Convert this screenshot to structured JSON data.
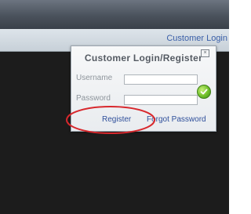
{
  "header": {
    "nav_link": "Customer Login"
  },
  "login_panel": {
    "title": "Customer Login/Register",
    "close_icon": "close-icon",
    "username_label": "Username",
    "username_value": "",
    "password_label": "Password",
    "password_value": "",
    "submit_icon": "checkmark-icon",
    "register_link": "Register",
    "forgot_link": "Forgot Password"
  },
  "colors": {
    "link": "#2f4f9b",
    "annotation": "#d8282d",
    "submit": "#6fbf2a"
  }
}
